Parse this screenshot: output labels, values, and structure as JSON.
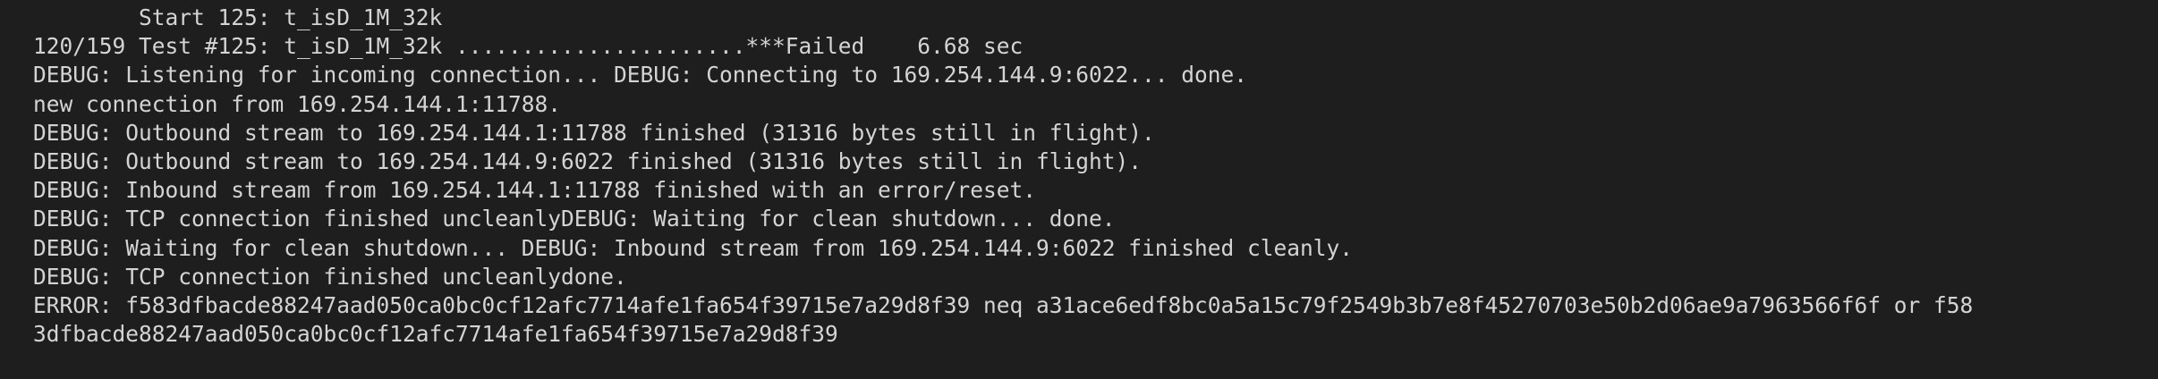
{
  "terminal": {
    "lines": [
      "        Start 125: t_isD_1M_32k",
      "120/159 Test #125: t_isD_1M_32k ......................***Failed    6.68 sec",
      "DEBUG: Listening for incoming connection... DEBUG: Connecting to 169.254.144.9:6022... done.",
      "new connection from 169.254.144.1:11788.",
      "DEBUG: Outbound stream to 169.254.144.1:11788 finished (31316 bytes still in flight).",
      "DEBUG: Outbound stream to 169.254.144.9:6022 finished (31316 bytes still in flight).",
      "DEBUG: Inbound stream from 169.254.144.1:11788 finished with an error/reset.",
      "DEBUG: TCP connection finished uncleanlyDEBUG: Waiting for clean shutdown... done.",
      "DEBUG: Waiting for clean shutdown... DEBUG: Inbound stream from 169.254.144.9:6022 finished cleanly.",
      "DEBUG: TCP connection finished uncleanlydone.",
      "ERROR: f583dfbacde88247aad050ca0bc0cf12afc7714afe1fa654f39715e7a29d8f39 neq a31ace6edf8bc0a5a15c79f2549b3b7e8f45270703e50b2d06ae9a7963566f6f or f58",
      "3dfbacde88247aad050ca0bc0cf12afc7714afe1fa654f39715e7a29d8f39"
    ]
  }
}
